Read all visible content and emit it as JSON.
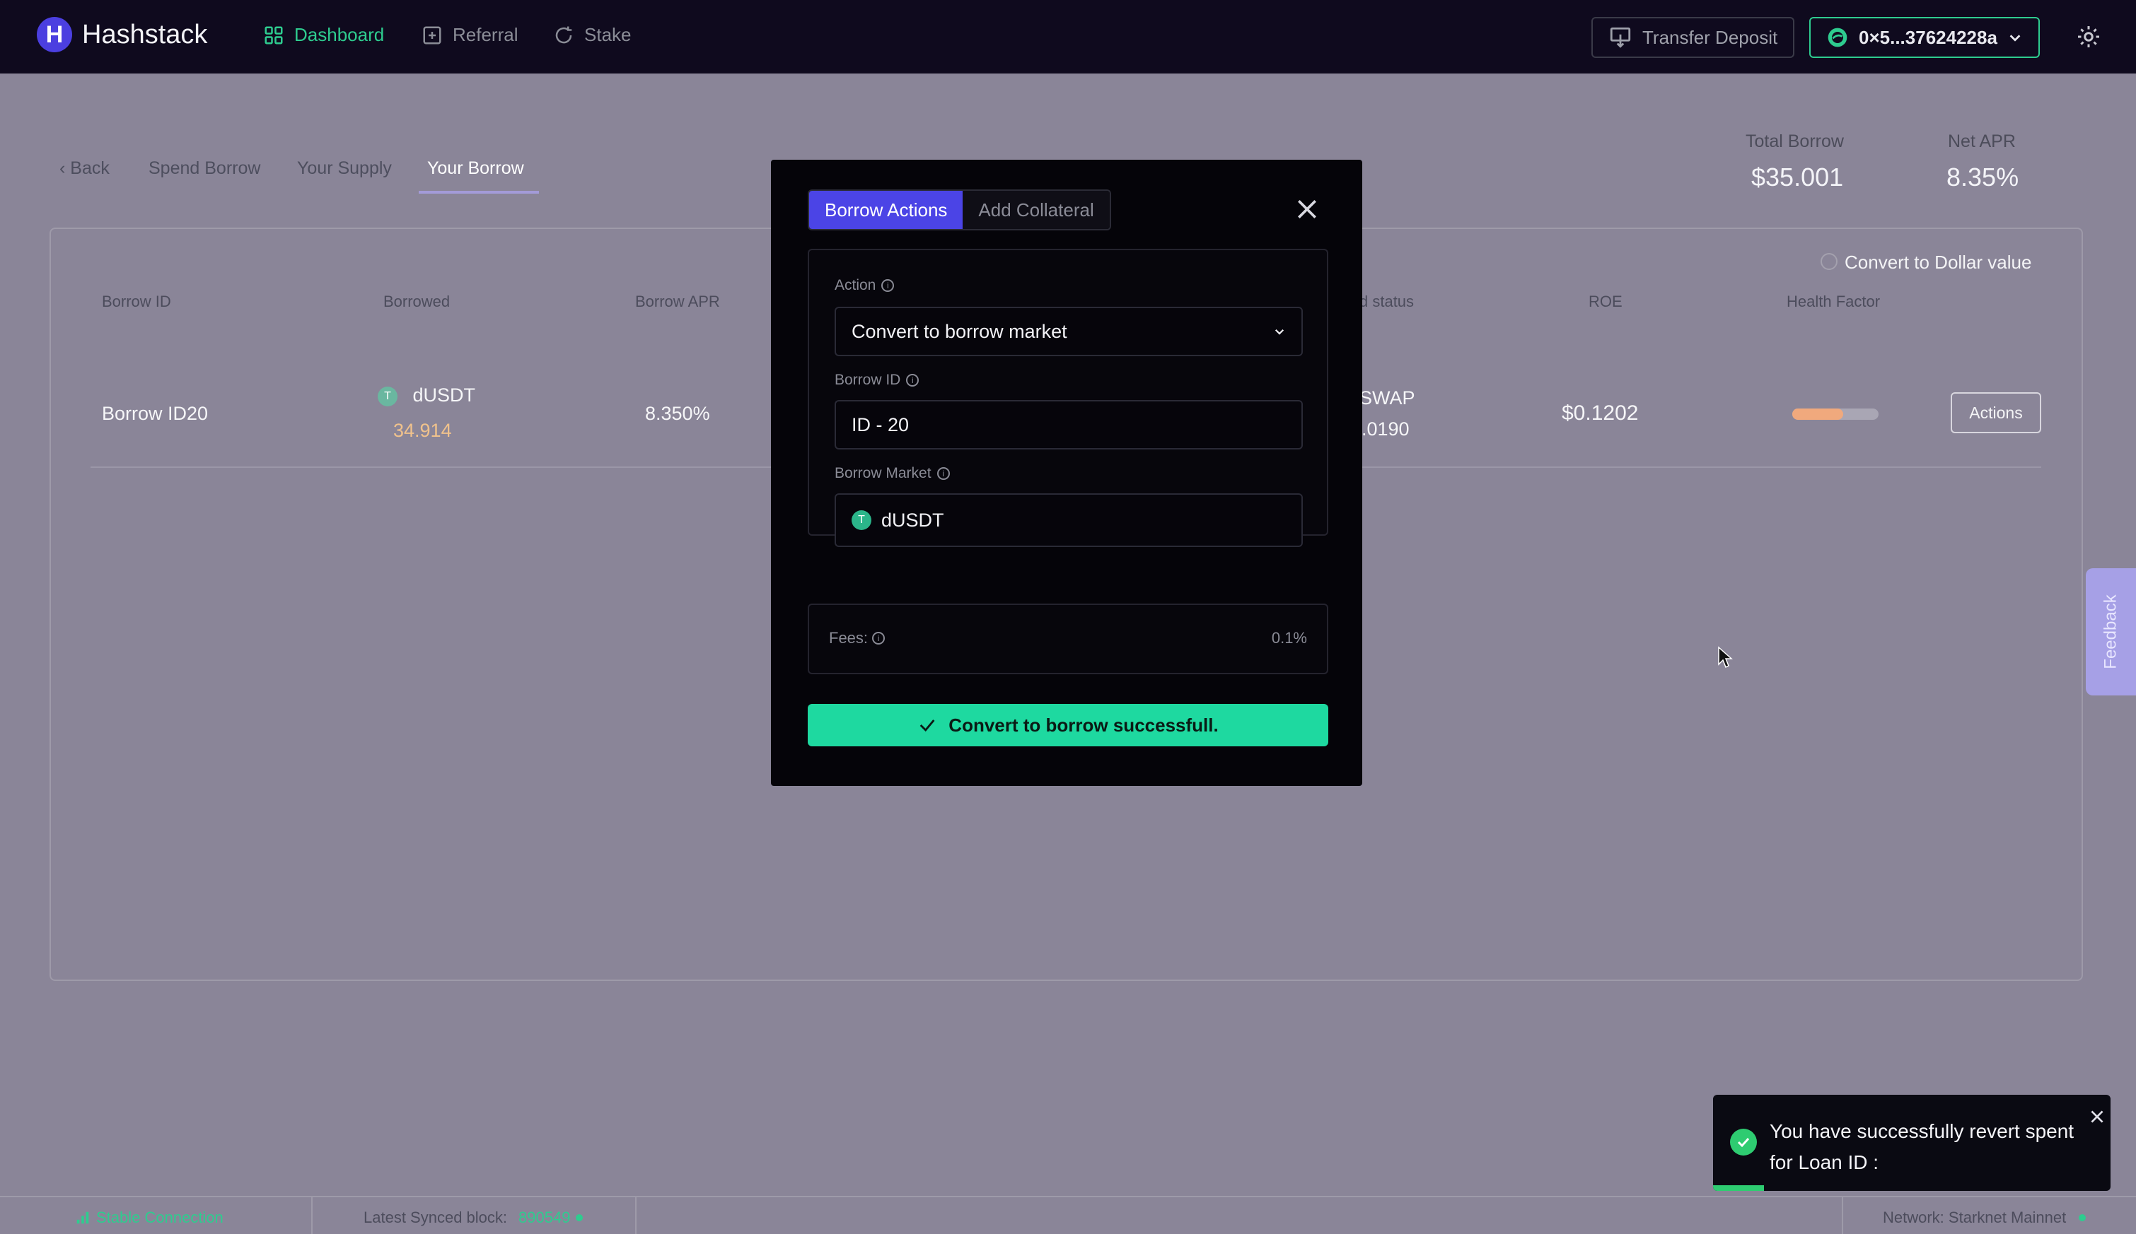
{
  "app": {
    "name": "Hashstack"
  },
  "nav": {
    "items": [
      {
        "label": "Dashboard",
        "icon": "grid-icon",
        "active": true
      },
      {
        "label": "Referral",
        "icon": "plus-square-icon",
        "active": false
      },
      {
        "label": "Stake",
        "icon": "refresh-icon",
        "active": false
      }
    ],
    "transfer_deposit": "Transfer Deposit",
    "wallet_address": "0×5...37624228a"
  },
  "subnav": {
    "back": "Back",
    "tabs": [
      "Spend Borrow",
      "Your Supply",
      "Your Borrow"
    ],
    "active_tab": "Your Borrow"
  },
  "stats": {
    "total_borrow_label": "Total Borrow",
    "total_borrow_value": "$35.001",
    "net_apr_label": "Net APR",
    "net_apr_value": "8.35%"
  },
  "table": {
    "convert_to_dollar": "Convert to Dollar value",
    "headers": [
      "Borrow ID",
      "Borrowed",
      "Borrow APR",
      "d status",
      "ROE",
      "Health Factor"
    ],
    "row": {
      "borrow_id": "Borrow ID20",
      "token": "dUSDT",
      "token_symbol": "T",
      "amount": "34.914",
      "apr": "8.350%",
      "status_line1": "SWAP",
      "status_line2": ").0190",
      "roe": "$0.1202",
      "health_factor_fraction": 0.59,
      "actions": "Actions"
    }
  },
  "modal": {
    "tabs": [
      "Borrow Actions",
      "Add Collateral"
    ],
    "active_tab": "Borrow Actions",
    "action_label": "Action",
    "action_value": "Convert to borrow market",
    "borrow_id_label": "Borrow ID",
    "borrow_id_value": "ID - 20",
    "borrow_market_label": "Borrow Market",
    "borrow_market_value": "dUSDT",
    "fees_label": "Fees:",
    "fees_value": "0.1%",
    "success_button": "Convert to borrow successfull."
  },
  "feedback": "Feedback",
  "toast": {
    "message": "You have successfully revert spent for Loan ID :"
  },
  "footer": {
    "connection": "Stable Connection",
    "synced_label": "Latest Synced block:",
    "synced_value": "890549",
    "network": "Network: Starknet Mainnet"
  },
  "colors": {
    "accent": "#4b44e6",
    "success": "#1ed9a0",
    "nav_active": "#2ecc8f",
    "topbar_bg": "#0f0a1e",
    "overlay_bg": "#8a8598"
  }
}
